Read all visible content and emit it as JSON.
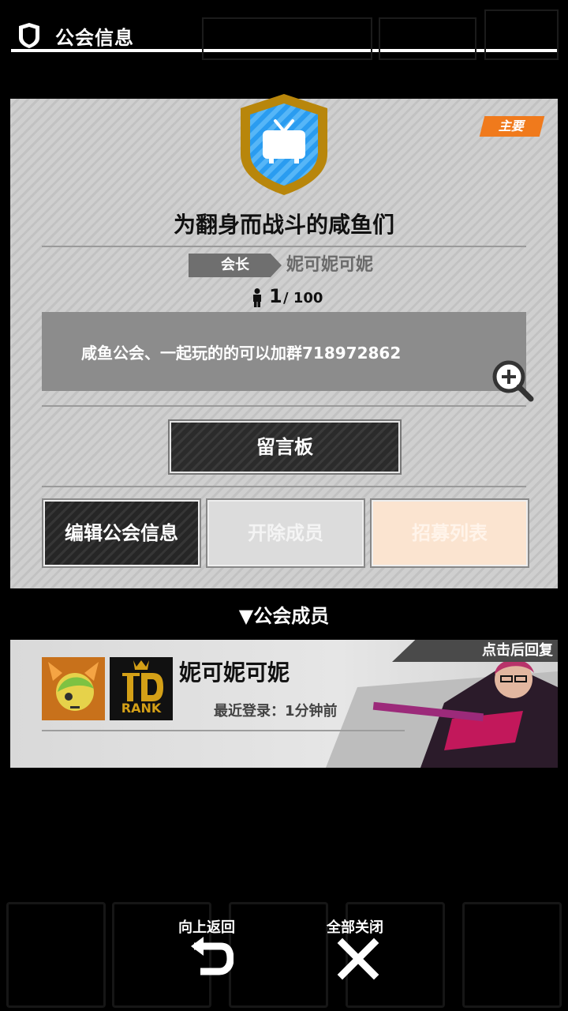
{
  "header": {
    "title": "公会信息"
  },
  "guild": {
    "badge": "主要",
    "name": "为翻身而战斗的咸鱼们",
    "leader_label": "会长",
    "leader_name": "妮可妮可妮",
    "members_current": "1",
    "members_max": "/ 100",
    "description": "咸鱼公会、一起玩的的可以加群718972862"
  },
  "buttons": {
    "board": "留言板",
    "edit": "编辑公会信息",
    "kick": "开除成员",
    "recruit": "招募列表"
  },
  "members_section": {
    "title": "▼公会成员"
  },
  "member": {
    "reply_hint": "点击后回复",
    "name": "妮可妮可妮",
    "rank_text": "RANK",
    "last_login": "最近登录：1分钟前"
  },
  "controls": {
    "back_label": "向上返回",
    "close_all_label": "全部关闭"
  },
  "colors": {
    "accent_orange": "#f07a1c",
    "emblem_gold": "#b8860b",
    "emblem_blue": "#1e90ff"
  }
}
